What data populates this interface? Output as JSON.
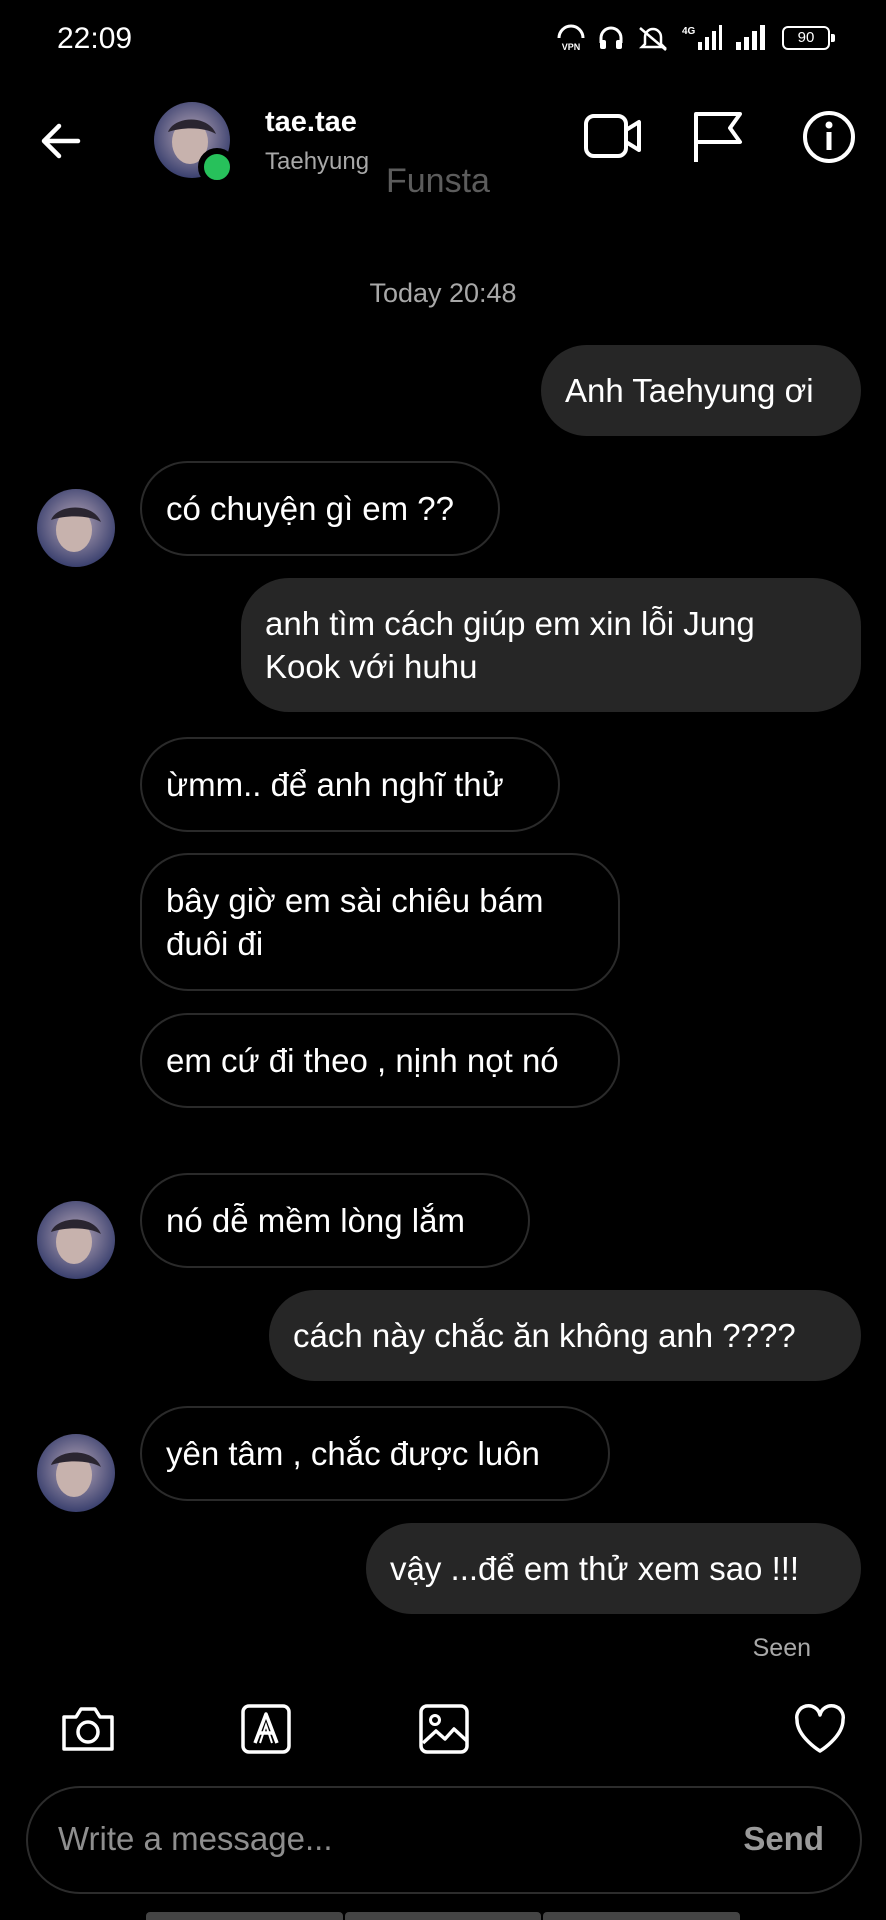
{
  "status_bar": {
    "time": "22:09",
    "battery": "90",
    "network": "4G"
  },
  "header": {
    "username": "tae.tae",
    "full_name": "Taehyung",
    "watermark": "Funsta",
    "online_color": "#27c15b"
  },
  "chat": {
    "timestamp": "Today 20:48",
    "messages": [
      {
        "side": "out",
        "text": "Anh Taehyung ơi"
      },
      {
        "side": "in",
        "text": "có chuyện gì em ??"
      },
      {
        "side": "out",
        "text": "anh tìm cách giúp em xin lỗi Jung Kook với huhu"
      },
      {
        "side": "in",
        "text": "ừmm.. để anh nghĩ thử"
      },
      {
        "side": "in",
        "text": "bây giờ em sài chiêu bám đuôi đi"
      },
      {
        "side": "in",
        "text": "em cứ đi theo , nịnh nọt nó"
      },
      {
        "side": "in",
        "text": "nó dễ mềm lòng lắm"
      },
      {
        "side": "out",
        "text": "cách này chắc ăn không anh ????"
      },
      {
        "side": "in",
        "text": "yên tâm , chắc được luôn"
      },
      {
        "side": "out",
        "text": "vậy ...để em thử xem sao !!!"
      }
    ],
    "seen": "Seen"
  },
  "composer": {
    "placeholder": "Write a message...",
    "send_label": "Send"
  },
  "icons": {
    "back": "arrow-left-icon",
    "video": "video-camera-icon",
    "flag": "flag-icon",
    "info": "info-icon",
    "camera": "camera-icon",
    "text_style": "text-style-icon",
    "gallery": "gallery-icon",
    "like": "heart-icon"
  }
}
